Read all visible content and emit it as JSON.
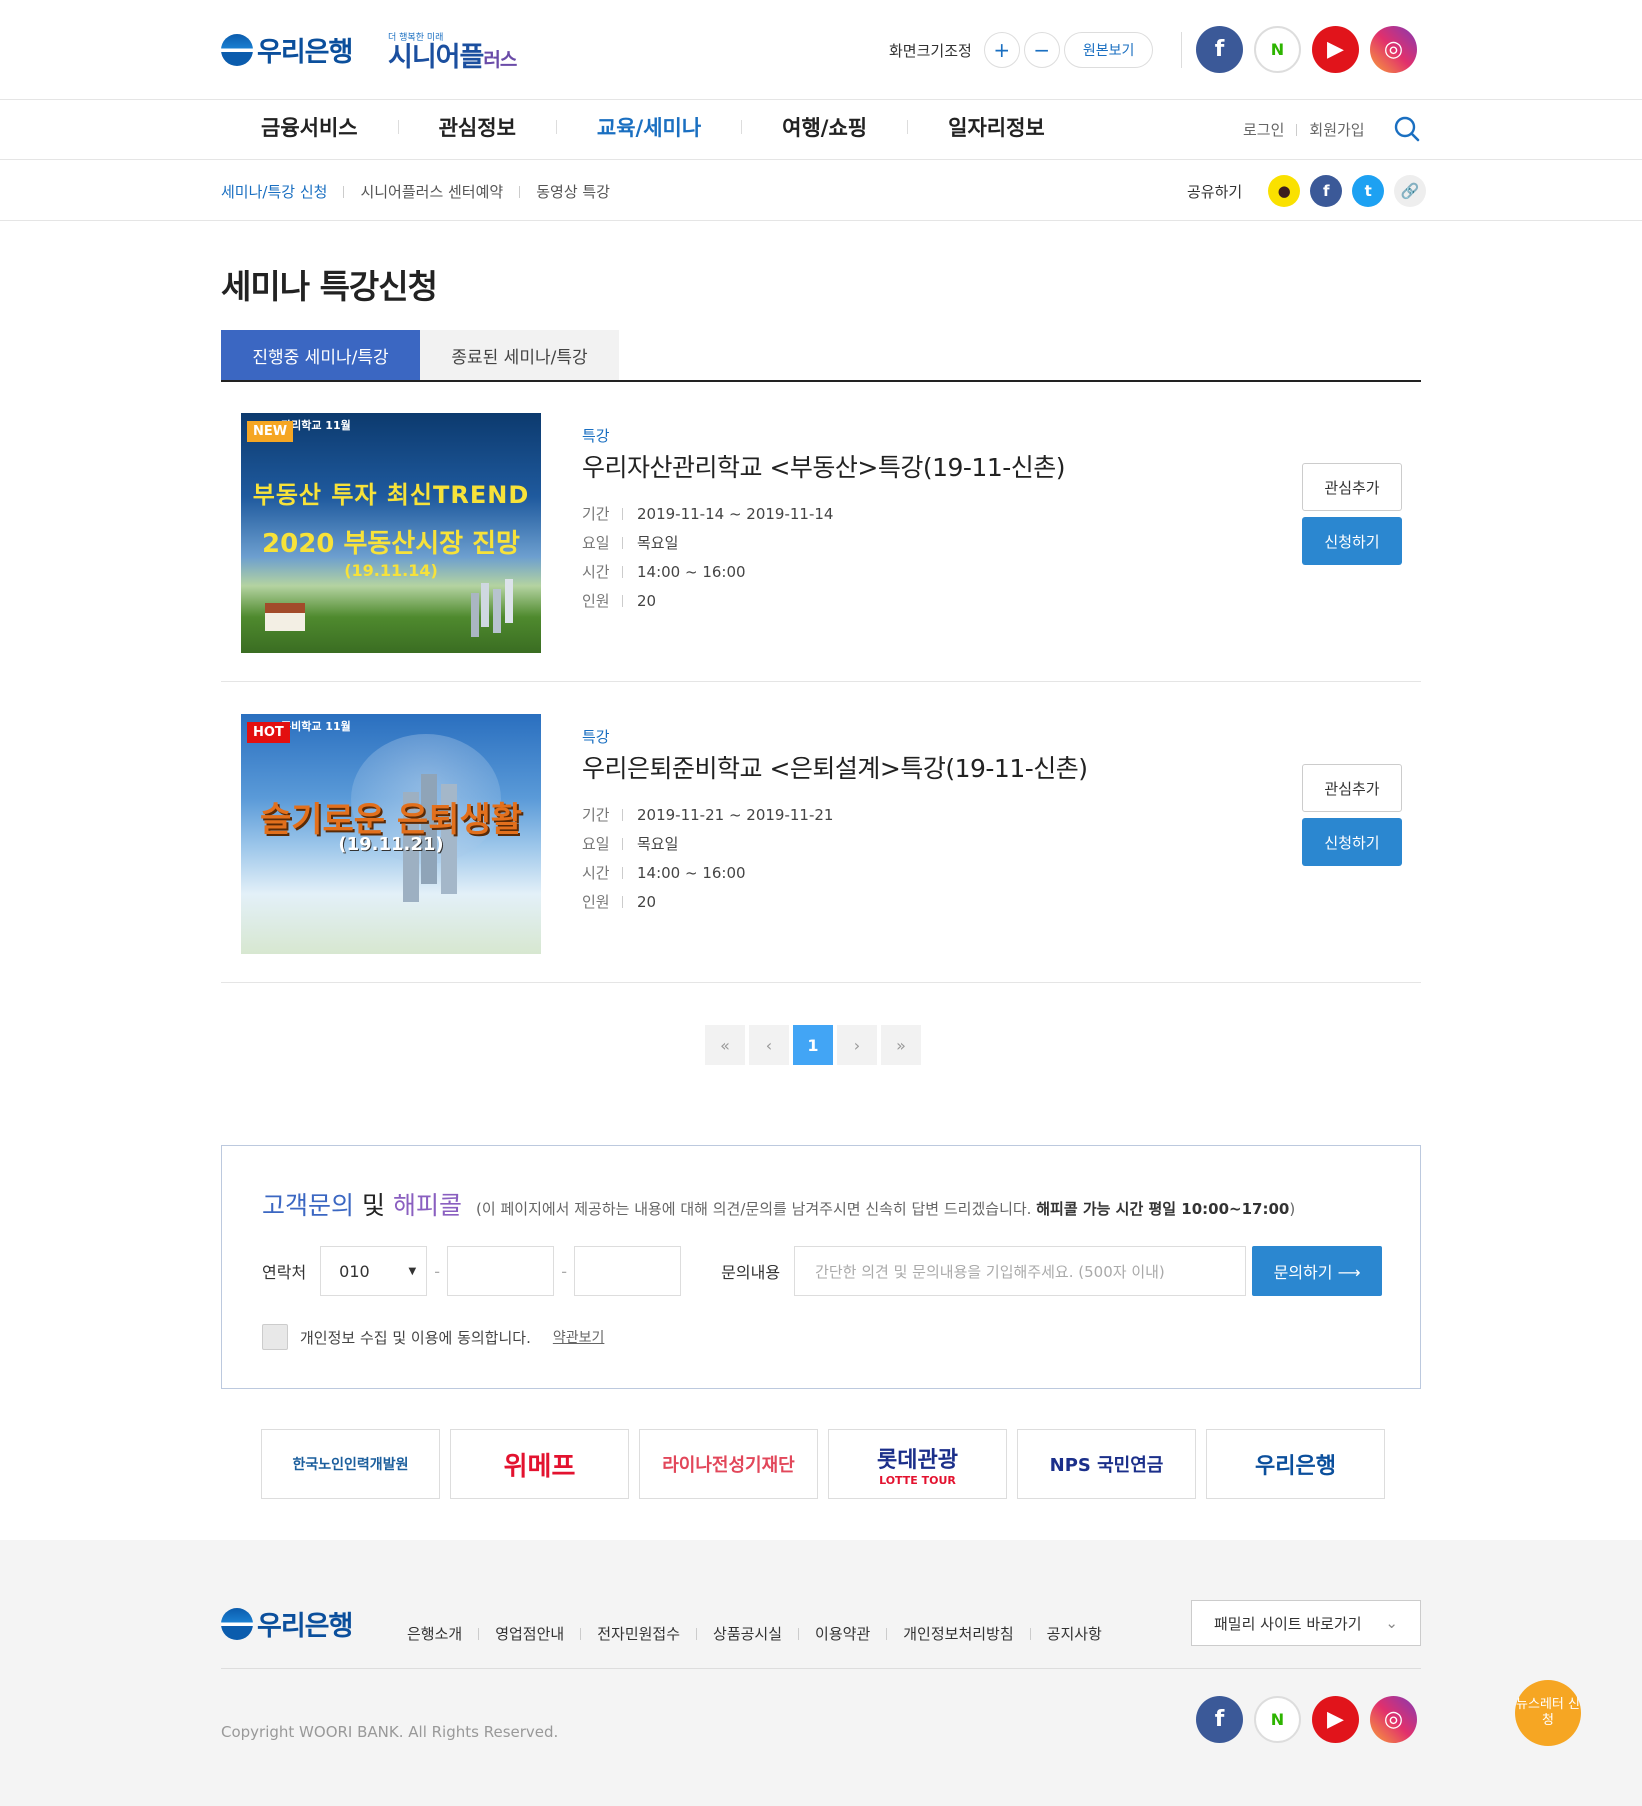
{
  "header": {
    "bank_logo": "우리은행",
    "senior_small": "더 행복한 미래",
    "senior_logo": "시니어플",
    "senior_logo_suffix": "러스",
    "zoom_label": "화면크기조정",
    "zoom_in": "+",
    "zoom_out": "−",
    "zoom_reset": "원본보기"
  },
  "social": [
    {
      "name": "facebook",
      "glyph": "f"
    },
    {
      "name": "blog",
      "glyph": "N"
    },
    {
      "name": "youtube",
      "glyph": "▶"
    },
    {
      "name": "instagram",
      "glyph": "◎"
    }
  ],
  "gnb": {
    "items": [
      "금융서비스",
      "관심정보",
      "교육/세미나",
      "여행/쇼핑",
      "일자리정보"
    ],
    "login": "로그인",
    "join": "회원가입"
  },
  "lnb": {
    "items": [
      "세미나/특강 신청",
      "시니어플러스 센터예약",
      "동영상 특강"
    ],
    "share_label": "공유하기"
  },
  "page_title": "세미나 특강신청",
  "tabs": [
    "진행중 세미나/특강",
    "종료된 세미나/특강"
  ],
  "seminars": [
    {
      "badge": "NEW",
      "thumb_top": "관리학교 11월",
      "thumb_line1": "부동산 투자 최신TREND",
      "thumb_line2": "2020 부동산시장 진망",
      "thumb_line3": "(19.11.14)",
      "category": "특강",
      "title": "우리자산관리학교 <부동산>특강(19-11-신촌)",
      "period_label": "기간",
      "period": "2019-11-14 ~ 2019-11-14",
      "day_label": "요일",
      "day": "목요일",
      "time_label": "시간",
      "time": "14:00 ~ 16:00",
      "people_label": "인원",
      "people": "20",
      "like_btn": "관심추가",
      "apply_btn": "신청하기"
    },
    {
      "badge": "HOT",
      "thumb_top": "준비학교 11월",
      "thumb_line1": "슬기로운 은퇴생활",
      "thumb_line2": "(19.11.21)",
      "category": "특강",
      "title": "우리은퇴준비학교 <은퇴설계>특강(19-11-신촌)",
      "period_label": "기간",
      "period": "2019-11-21 ~ 2019-11-21",
      "day_label": "요일",
      "day": "목요일",
      "time_label": "시간",
      "time": "14:00 ~ 16:00",
      "people_label": "인원",
      "people": "20",
      "like_btn": "관심추가",
      "apply_btn": "신청하기"
    }
  ],
  "pager": {
    "first": "«",
    "prev": "‹",
    "current": "1",
    "next": "›",
    "last": "»"
  },
  "inquiry": {
    "title_a": "고객문의",
    "title_b": "및",
    "title_c": "해피콜",
    "desc": "(이 페이지에서 제공하는 내용에 대해 의견/문의를 남겨주시면 신속히 답변 드리겠습니다.",
    "desc_bold": "해피콜 가능 시간 평일 10:00~17:00",
    "desc_end": ")",
    "phone_label": "연락처",
    "phone_prefix": "010",
    "content_label": "문의내용",
    "content_placeholder": "간단한 의견 및 문의내용을 기입해주세요. (500자 이내)",
    "submit": "문의하기 ⟶",
    "agree_text": "개인정보 수집 및 이용에 동의합니다.",
    "terms_link": "약관보기"
  },
  "partners": [
    "한국노인인력개발원",
    "위메프",
    "라이나전성기재단",
    "롯데관광",
    "NPS 국민연금",
    "우리은행"
  ],
  "partner_sub": "LOTTE TOUR",
  "footer": {
    "logo": "우리은행",
    "nav": [
      "은행소개",
      "영업점안내",
      "전자민원접수",
      "상품공시실",
      "이용약관",
      "개인정보처리방침",
      "공지사항"
    ],
    "family_site": "패밀리 사이트 바로가기",
    "copyright": "Copyright WOORI BANK. All Rights Reserved.",
    "newsletter": "뉴스레터 신청"
  },
  "colors": {
    "accent": "#1a6fc1",
    "tab_active": "#3b67c2",
    "button": "#2b87d0",
    "badge_new": "#f5a623",
    "badge_hot": "#e30f0f"
  }
}
